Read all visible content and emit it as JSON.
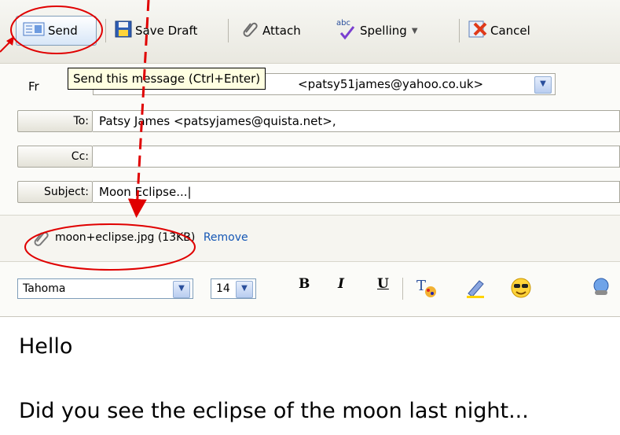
{
  "toolbar": {
    "send": "Send",
    "save_draft": "Save Draft",
    "attach": "Attach",
    "spelling": "Spelling",
    "spelling_icon_text": "abc",
    "cancel": "Cancel"
  },
  "tooltip": "Send this message (Ctrl+Enter)",
  "compose": {
    "from_label": "Fr",
    "from_value": "<patsy51james@yahoo.co.uk>",
    "to_label": "To:",
    "to_value": "Patsy James <patsyjames@quista.net>,",
    "cc_label": "Cc:",
    "cc_value": "",
    "subject_label": "Subject:",
    "subject_value": "Moon Eclipse...|"
  },
  "attachment": {
    "filename": "moon+eclipse.jpg",
    "size": "(13KB)",
    "remove": "Remove"
  },
  "format": {
    "font_name": "Tahoma",
    "font_size": "14",
    "bold": "B",
    "italic": "I",
    "underline": "U"
  },
  "body": {
    "line1": "Hello",
    "line2": "Did you see the eclipse of the moon last night..."
  },
  "colors": {
    "annotation": "#e00000",
    "link": "#1557b5"
  }
}
